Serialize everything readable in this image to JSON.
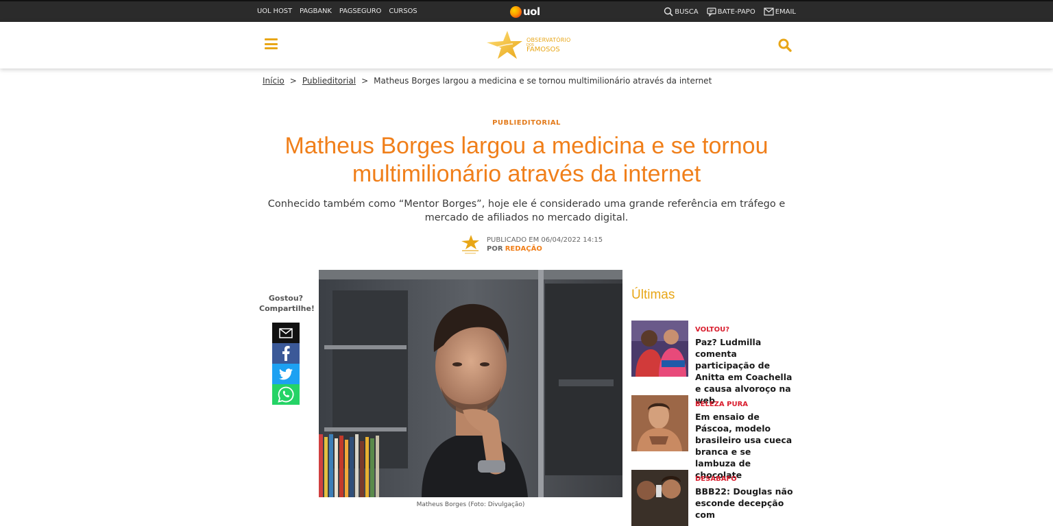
{
  "uolbar": {
    "links": [
      "UOL HOST",
      "PAGBANK",
      "PAGSEGURO",
      "CURSOS"
    ],
    "logo_text": "uol",
    "tools": [
      {
        "icon": "search-icon",
        "label": "BUSCA"
      },
      {
        "icon": "chat-icon",
        "label": "BATE-PAPO"
      },
      {
        "icon": "mail-icon",
        "label": "EMAIL"
      }
    ]
  },
  "header": {
    "logo_line1": "OBSERVATÓRIO",
    "logo_line2": "DOS",
    "logo_line3": "FAMOSOS",
    "accent": "#e8a617"
  },
  "breadcrumb": {
    "home": "Início",
    "separator": ">",
    "section": "Publieditorial",
    "current": "Matheus Borges largou a medicina e se tornou multimilionário através da internet"
  },
  "article": {
    "kicker": "PUBLIEDITORIAL",
    "title": "Matheus Borges largou a medicina e se tornou multimilionário através da internet",
    "subtitle": "Conhecido também como “Mentor Borges”, hoje ele é considerado uma grande referência em tráfego e mercado de afiliados no mercado digital.",
    "published_label": "PUBLICADO EM 06/04/2022",
    "published_time": "14:15",
    "by_label": "POR",
    "author": "REDAÇÃO",
    "title_color": "#f07f1a",
    "caption": "Matheus Borges (Foto: Divulgação)"
  },
  "share": {
    "label_line1": "Gostou?",
    "label_line2": "Compartilhe!",
    "buttons": [
      "email-icon",
      "facebook-icon",
      "twitter-icon",
      "whatsapp-icon"
    ]
  },
  "sidebar": {
    "heading": "Últimas",
    "items": [
      {
        "tag": "VOLTOU?",
        "title": "Paz? Ludmilla comenta participação de Anitta em Coachella e causa alvoroço na web"
      },
      {
        "tag": "BELEZA PURA",
        "title": "Em ensaio de Páscoa, modelo brasileiro usa cueca branca e se lambuza de chocolate"
      },
      {
        "tag": "DESABAFO",
        "title": "BBB22: Douglas não esconde decepção com"
      }
    ],
    "tag_color": "#d91e2e"
  }
}
